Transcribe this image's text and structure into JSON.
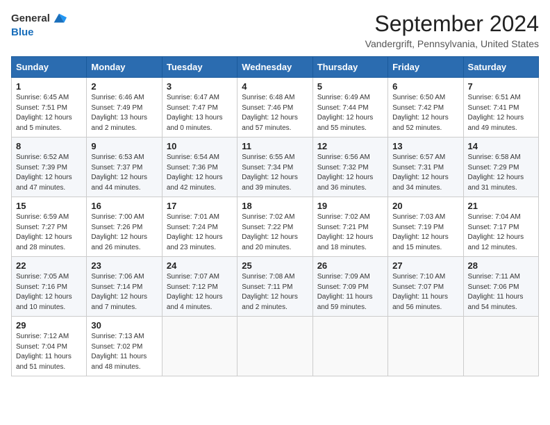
{
  "header": {
    "logo_general": "General",
    "logo_blue": "Blue",
    "title": "September 2024",
    "location": "Vandergrift, Pennsylvania, United States"
  },
  "days_of_week": [
    "Sunday",
    "Monday",
    "Tuesday",
    "Wednesday",
    "Thursday",
    "Friday",
    "Saturday"
  ],
  "weeks": [
    [
      {
        "day": 1,
        "sunrise": "6:45 AM",
        "sunset": "7:51 PM",
        "daylight": "12 hours and 5 minutes."
      },
      {
        "day": 2,
        "sunrise": "6:46 AM",
        "sunset": "7:49 PM",
        "daylight": "13 hours and 2 minutes."
      },
      {
        "day": 3,
        "sunrise": "6:47 AM",
        "sunset": "7:47 PM",
        "daylight": "13 hours and 0 minutes."
      },
      {
        "day": 4,
        "sunrise": "6:48 AM",
        "sunset": "7:46 PM",
        "daylight": "12 hours and 57 minutes."
      },
      {
        "day": 5,
        "sunrise": "6:49 AM",
        "sunset": "7:44 PM",
        "daylight": "12 hours and 55 minutes."
      },
      {
        "day": 6,
        "sunrise": "6:50 AM",
        "sunset": "7:42 PM",
        "daylight": "12 hours and 52 minutes."
      },
      {
        "day": 7,
        "sunrise": "6:51 AM",
        "sunset": "7:41 PM",
        "daylight": "12 hours and 49 minutes."
      }
    ],
    [
      {
        "day": 8,
        "sunrise": "6:52 AM",
        "sunset": "7:39 PM",
        "daylight": "12 hours and 47 minutes."
      },
      {
        "day": 9,
        "sunrise": "6:53 AM",
        "sunset": "7:37 PM",
        "daylight": "12 hours and 44 minutes."
      },
      {
        "day": 10,
        "sunrise": "6:54 AM",
        "sunset": "7:36 PM",
        "daylight": "12 hours and 42 minutes."
      },
      {
        "day": 11,
        "sunrise": "6:55 AM",
        "sunset": "7:34 PM",
        "daylight": "12 hours and 39 minutes."
      },
      {
        "day": 12,
        "sunrise": "6:56 AM",
        "sunset": "7:32 PM",
        "daylight": "12 hours and 36 minutes."
      },
      {
        "day": 13,
        "sunrise": "6:57 AM",
        "sunset": "7:31 PM",
        "daylight": "12 hours and 34 minutes."
      },
      {
        "day": 14,
        "sunrise": "6:58 AM",
        "sunset": "7:29 PM",
        "daylight": "12 hours and 31 minutes."
      }
    ],
    [
      {
        "day": 15,
        "sunrise": "6:59 AM",
        "sunset": "7:27 PM",
        "daylight": "12 hours and 28 minutes."
      },
      {
        "day": 16,
        "sunrise": "7:00 AM",
        "sunset": "7:26 PM",
        "daylight": "12 hours and 26 minutes."
      },
      {
        "day": 17,
        "sunrise": "7:01 AM",
        "sunset": "7:24 PM",
        "daylight": "12 hours and 23 minutes."
      },
      {
        "day": 18,
        "sunrise": "7:02 AM",
        "sunset": "7:22 PM",
        "daylight": "12 hours and 20 minutes."
      },
      {
        "day": 19,
        "sunrise": "7:02 AM",
        "sunset": "7:21 PM",
        "daylight": "12 hours and 18 minutes."
      },
      {
        "day": 20,
        "sunrise": "7:03 AM",
        "sunset": "7:19 PM",
        "daylight": "12 hours and 15 minutes."
      },
      {
        "day": 21,
        "sunrise": "7:04 AM",
        "sunset": "7:17 PM",
        "daylight": "12 hours and 12 minutes."
      }
    ],
    [
      {
        "day": 22,
        "sunrise": "7:05 AM",
        "sunset": "7:16 PM",
        "daylight": "12 hours and 10 minutes."
      },
      {
        "day": 23,
        "sunrise": "7:06 AM",
        "sunset": "7:14 PM",
        "daylight": "12 hours and 7 minutes."
      },
      {
        "day": 24,
        "sunrise": "7:07 AM",
        "sunset": "7:12 PM",
        "daylight": "12 hours and 4 minutes."
      },
      {
        "day": 25,
        "sunrise": "7:08 AM",
        "sunset": "7:11 PM",
        "daylight": "12 hours and 2 minutes."
      },
      {
        "day": 26,
        "sunrise": "7:09 AM",
        "sunset": "7:09 PM",
        "daylight": "11 hours and 59 minutes."
      },
      {
        "day": 27,
        "sunrise": "7:10 AM",
        "sunset": "7:07 PM",
        "daylight": "11 hours and 56 minutes."
      },
      {
        "day": 28,
        "sunrise": "7:11 AM",
        "sunset": "7:06 PM",
        "daylight": "11 hours and 54 minutes."
      }
    ],
    [
      {
        "day": 29,
        "sunrise": "7:12 AM",
        "sunset": "7:04 PM",
        "daylight": "11 hours and 51 minutes."
      },
      {
        "day": 30,
        "sunrise": "7:13 AM",
        "sunset": "7:02 PM",
        "daylight": "11 hours and 48 minutes."
      },
      null,
      null,
      null,
      null,
      null
    ]
  ]
}
